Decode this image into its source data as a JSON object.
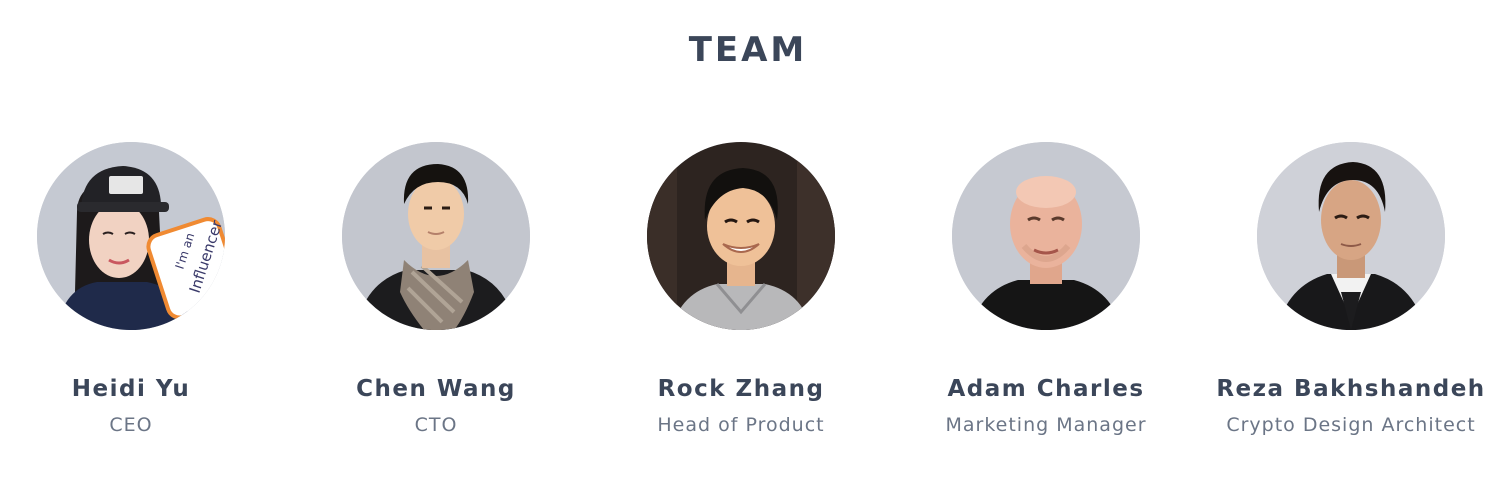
{
  "section": {
    "title": "TEAM"
  },
  "members": [
    {
      "name": "Heidi Yu",
      "role": "CEO",
      "sign_text": "I'm an Influencer",
      "avatar_bg": "#c5c9d2"
    },
    {
      "name": "Chen Wang",
      "role": "CTO",
      "avatar_bg": "#c3c6ce"
    },
    {
      "name": "Rock Zhang",
      "role": "Head of Product",
      "avatar_bg": "#2d2420"
    },
    {
      "name": "Adam Charles",
      "role": "Marketing Manager",
      "avatar_bg": "#c6c9d1"
    },
    {
      "name": "Reza Bakhshandeh",
      "role": "Crypto Design Architect",
      "avatar_bg": "#cfd1d8"
    }
  ],
  "colors": {
    "heading": "#3b4659",
    "subtext": "#6b7586",
    "background": "#ffffff"
  }
}
